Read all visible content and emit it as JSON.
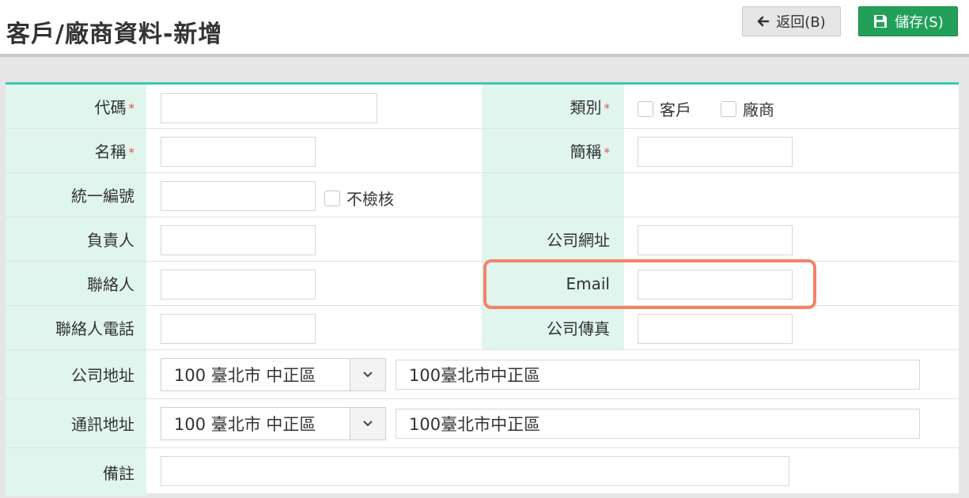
{
  "header": {
    "title": "客戶/廠商資料-新增",
    "back_label": "返回(B)",
    "save_label": "儲存(S)"
  },
  "form": {
    "code_label": "代碼",
    "type_label": "類別",
    "type_options": [
      "客戶",
      "廠商"
    ],
    "name_label": "名稱",
    "short_name_label": "簡稱",
    "tax_id_label": "統一編號",
    "no_check_label": "不檢核",
    "owner_label": "負責人",
    "website_label": "公司網址",
    "contact_label": "聯絡人",
    "email_label": "Email",
    "contact_phone_label": "聯絡人電話",
    "fax_label": "公司傳真",
    "company_address_label": "公司地址",
    "company_address_select": "100 臺北市 中正區",
    "company_address_value": "100臺北市中正區",
    "mailing_address_label": "通訊地址",
    "mailing_address_select": "100 臺北市 中正區",
    "mailing_address_value": "100臺北市中正區",
    "remarks_label": "備註",
    "required_mark": "*"
  },
  "colors": {
    "accent": "#3cc8b4",
    "label_bg": "#e0f5ee",
    "save_bg": "#22a05a",
    "required": "#e05050",
    "highlight": "#f28468"
  }
}
